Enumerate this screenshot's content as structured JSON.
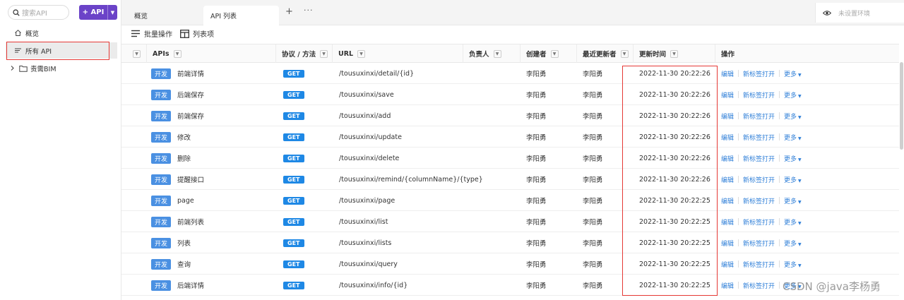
{
  "sidebar": {
    "search_placeholder": "搜索API",
    "new_button": "+ API",
    "items": [
      {
        "label": "概览"
      },
      {
        "label": "所有 API"
      },
      {
        "label": "责需BIM"
      }
    ]
  },
  "tabs": [
    {
      "label": "概览"
    },
    {
      "label": "API 列表"
    }
  ],
  "environment": {
    "label": "未设置环境"
  },
  "toolbar": {
    "batch": "批量操作",
    "columns": "列表项"
  },
  "table": {
    "headers": {
      "apis": "APIs",
      "method": "协议 / 方法",
      "url": "URL",
      "owner": "负责人",
      "creator": "创建者",
      "updater": "最近更新者",
      "updated": "更新时间",
      "actions": "操作"
    },
    "actions": {
      "edit": "编辑",
      "open_tab": "新标签打开",
      "more": "更多"
    },
    "rows": [
      {
        "status": "开发",
        "name": "前端详情",
        "method": "GET",
        "url": "/tousuxinxi/detail/{id}",
        "creator": "李阳勇",
        "updater": "李阳勇",
        "updated": "2022-11-30 20:22:26"
      },
      {
        "status": "开发",
        "name": "后端保存",
        "method": "GET",
        "url": "/tousuxinxi/save",
        "creator": "李阳勇",
        "updater": "李阳勇",
        "updated": "2022-11-30 20:22:26"
      },
      {
        "status": "开发",
        "name": "前端保存",
        "method": "GET",
        "url": "/tousuxinxi/add",
        "creator": "李阳勇",
        "updater": "李阳勇",
        "updated": "2022-11-30 20:22:26"
      },
      {
        "status": "开发",
        "name": "修改",
        "method": "GET",
        "url": "/tousuxinxi/update",
        "creator": "李阳勇",
        "updater": "李阳勇",
        "updated": "2022-11-30 20:22:26"
      },
      {
        "status": "开发",
        "name": "删除",
        "method": "GET",
        "url": "/tousuxinxi/delete",
        "creator": "李阳勇",
        "updater": "李阳勇",
        "updated": "2022-11-30 20:22:26"
      },
      {
        "status": "开发",
        "name": "提醒接口",
        "method": "GET",
        "url": "/tousuxinxi/remind/{columnName}/{type}",
        "creator": "李阳勇",
        "updater": "李阳勇",
        "updated": "2022-11-30 20:22:26"
      },
      {
        "status": "开发",
        "name": "page",
        "method": "GET",
        "url": "/tousuxinxi/page",
        "creator": "李阳勇",
        "updater": "李阳勇",
        "updated": "2022-11-30 20:22:25"
      },
      {
        "status": "开发",
        "name": "前端列表",
        "method": "GET",
        "url": "/tousuxinxi/list",
        "creator": "李阳勇",
        "updater": "李阳勇",
        "updated": "2022-11-30 20:22:25"
      },
      {
        "status": "开发",
        "name": "列表",
        "method": "GET",
        "url": "/tousuxinxi/lists",
        "creator": "李阳勇",
        "updater": "李阳勇",
        "updated": "2022-11-30 20:22:25"
      },
      {
        "status": "开发",
        "name": "查询",
        "method": "GET",
        "url": "/tousuxinxi/query",
        "creator": "李阳勇",
        "updater": "李阳勇",
        "updated": "2022-11-30 20:22:25"
      },
      {
        "status": "开发",
        "name": "后端详情",
        "method": "GET",
        "url": "/tousuxinxi/info/{id}",
        "creator": "李阳勇",
        "updater": "李阳勇",
        "updated": "2022-11-30 20:22:25"
      }
    ]
  },
  "watermark": "CSDN @java李杨勇",
  "colors": {
    "accent": "#6b43c8",
    "method_get": "#1e88e5",
    "status_tag": "#4a90e2",
    "link": "#2f7fd8",
    "highlight": "#e53935"
  }
}
